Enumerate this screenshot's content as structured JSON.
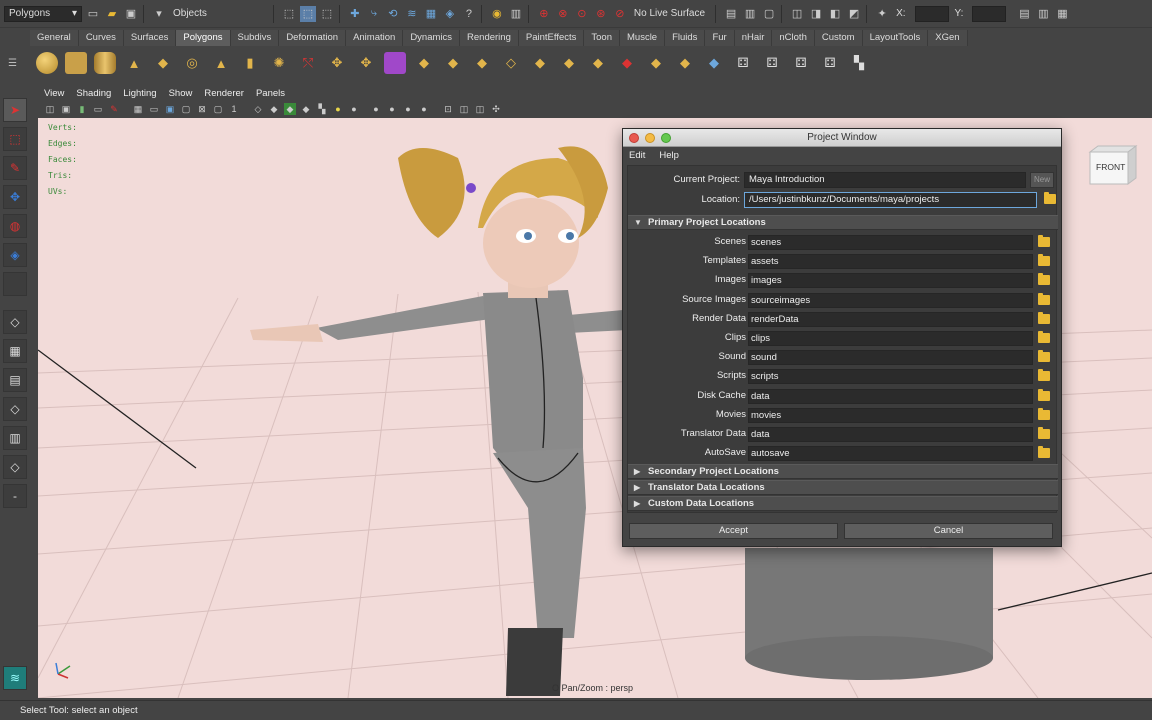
{
  "status_line": {
    "mode": "Polygons",
    "selection_mode": "Objects",
    "live_surface": "No Live Surface",
    "x_label": "X:",
    "y_label": "Y:"
  },
  "shelf_tabs": [
    "General",
    "Curves",
    "Surfaces",
    "Polygons",
    "Subdivs",
    "Deformation",
    "Animation",
    "Dynamics",
    "Rendering",
    "PaintEffects",
    "Toon",
    "Muscle",
    "Fluids",
    "Fur",
    "nHair",
    "nCloth",
    "Custom",
    "LayoutTools",
    "XGen"
  ],
  "active_shelf_tab": "Polygons",
  "view_menu": [
    "View",
    "Shading",
    "Lighting",
    "Show",
    "Renderer",
    "Panels"
  ],
  "hud": {
    "labels": [
      "Verts:",
      "Edges:",
      "Faces:",
      "Tris:",
      "UVs:"
    ]
  },
  "viewcube": {
    "label": "FRONT"
  },
  "viewport_label": "O Pan/Zoom : persp",
  "help_line": "Select Tool: select an object",
  "project_window": {
    "title": "Project Window",
    "menu": [
      "Edit",
      "Help"
    ],
    "current_project_label": "Current Project:",
    "current_project": "Maya Introduction",
    "new_button": "New",
    "location_label": "Location:",
    "location": "/Users/justinbkunz/Documents/maya/projects",
    "primary_section": "Primary Project Locations",
    "locations": [
      {
        "label": "Scenes",
        "value": "scenes"
      },
      {
        "label": "Templates",
        "value": "assets"
      },
      {
        "label": "Images",
        "value": "images"
      },
      {
        "label": "Source Images",
        "value": "sourceimages"
      },
      {
        "label": "Render Data",
        "value": "renderData"
      },
      {
        "label": "Clips",
        "value": "clips"
      },
      {
        "label": "Sound",
        "value": "sound"
      },
      {
        "label": "Scripts",
        "value": "scripts"
      },
      {
        "label": "Disk Cache",
        "value": "data"
      },
      {
        "label": "Movies",
        "value": "movies"
      },
      {
        "label": "Translator Data",
        "value": "data"
      },
      {
        "label": "AutoSave",
        "value": "autosave"
      }
    ],
    "collapsed_sections": [
      "Secondary Project Locations",
      "Translator Data Locations",
      "Custom Data Locations"
    ],
    "accept_button": "Accept",
    "cancel_button": "Cancel"
  }
}
